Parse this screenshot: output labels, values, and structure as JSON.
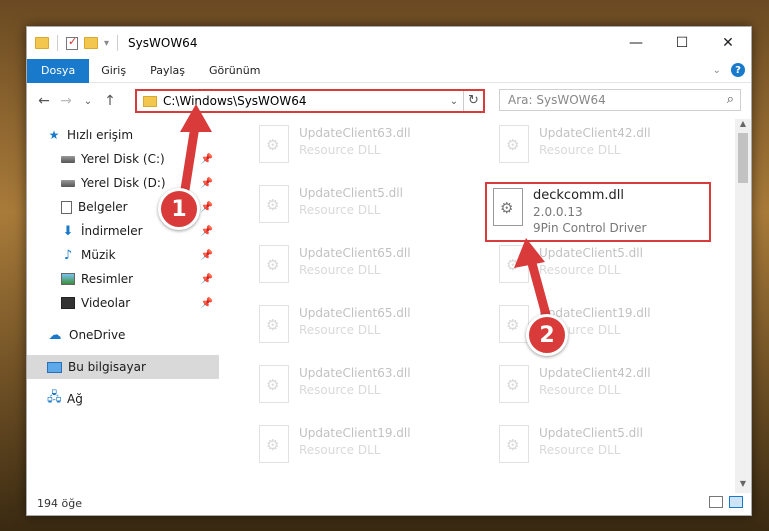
{
  "window": {
    "title": "SysWOW64",
    "controls": {
      "minimize": "—",
      "maximize": "☐",
      "close": "✕"
    }
  },
  "ribbon": {
    "tabs": [
      "Dosya",
      "Giriş",
      "Paylaş",
      "Görünüm"
    ],
    "help": "?"
  },
  "nav": {
    "back": "←",
    "forward": "→",
    "recent": "⌄",
    "up": "↑",
    "address": "C:\\Windows\\SysWOW64",
    "search_placeholder": "Ara: SysWOW64"
  },
  "sidebar": {
    "items": [
      {
        "label": "Hızlı erişim",
        "icon": "star-icon"
      },
      {
        "label": "Yerel Disk (C:)",
        "icon": "disk-icon",
        "pinned": true
      },
      {
        "label": "Yerel Disk (D:)",
        "icon": "disk-icon",
        "pinned": true
      },
      {
        "label": "Belgeler",
        "icon": "document-icon",
        "pinned": true
      },
      {
        "label": "İndirmeler",
        "icon": "download-icon",
        "pinned": true
      },
      {
        "label": "Müzik",
        "icon": "music-icon",
        "pinned": true
      },
      {
        "label": "Resimler",
        "icon": "pictures-icon",
        "pinned": true
      },
      {
        "label": "Videolar",
        "icon": "videos-icon",
        "pinned": true
      },
      {
        "label": "OneDrive",
        "icon": "cloud-icon"
      },
      {
        "label": "Bu bilgisayar",
        "icon": "computer-icon",
        "selected": true
      },
      {
        "label": "Ağ",
        "icon": "network-icon"
      }
    ]
  },
  "files": [
    {
      "name": "UpdateClient63.dll",
      "desc": "Resource DLL"
    },
    {
      "name": "UpdateClient42.dll",
      "desc": "Resource DLL"
    },
    {
      "name": "UpdateClient5.dll",
      "desc": "Resource DLL"
    },
    {
      "name": "deckcomm.dll",
      "version": "2.0.0.13",
      "desc": "9Pin Control Driver"
    },
    {
      "name": "UpdateClient65.dll",
      "desc": "Resource DLL"
    },
    {
      "name": "UpdateClient5.dll",
      "desc": "Resource DLL"
    },
    {
      "name": "UpdateClient65.dll",
      "desc": "Resource DLL"
    },
    {
      "name": "UpdateClient19.dll",
      "desc": "Resource DLL"
    },
    {
      "name": "UpdateClient63.dll",
      "desc": "Resource DLL"
    },
    {
      "name": "UpdateClient42.dll",
      "desc": "Resource DLL"
    },
    {
      "name": "UpdateClient19.dll",
      "desc": "Resource DLL"
    },
    {
      "name": "UpdateClient5.dll",
      "desc": "Resource DLL"
    }
  ],
  "status": {
    "count": "194 öğe"
  },
  "callouts": [
    "1",
    "2"
  ],
  "colors": {
    "accent": "#1979ca",
    "callout": "#d93a3a",
    "highlight_border": "#d83b3b"
  }
}
